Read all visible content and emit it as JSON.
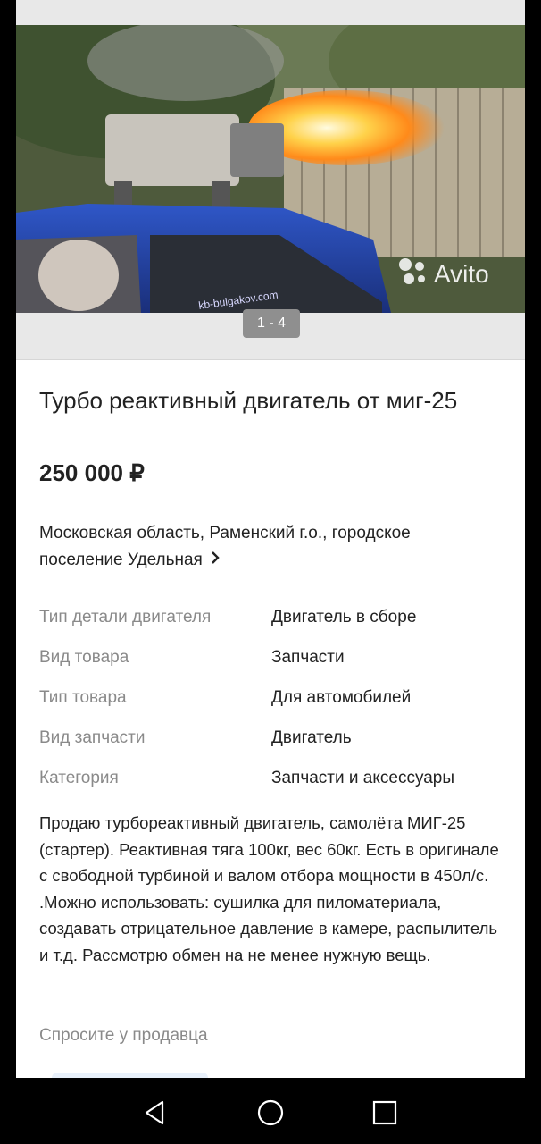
{
  "gallery": {
    "counter": "1 - 4",
    "watermark": "Avito",
    "plate_text": "kb-bulgakov.com"
  },
  "listing": {
    "title": "Турбо реактивный двигатель от миг-25",
    "price": "250 000 ₽",
    "location": "Московская область, Раменский г.о., городское поселение Удельная"
  },
  "params": [
    {
      "key": "Тип детали двигателя",
      "value": "Двигатель в сборе"
    },
    {
      "key": "Вид товара",
      "value": "Запчасти"
    },
    {
      "key": "Тип товара",
      "value": "Для автомобилей"
    },
    {
      "key": "Вид запчасти",
      "value": "Двигатель"
    },
    {
      "key": "Категория",
      "value": "Запчасти и аксессуары"
    }
  ],
  "description": "Продаю турбореактивный двигатель, самолёта МИГ-25 (стартер). Реактивная тяга 100кг, вес 60кг. Есть в оригинале с свободной турбиной и валом отбора мощности в 450л/с. .Можно использовать: сушилка для пиломатериала, создавать отрицательное давление в камере, распылитель и т.д.  Рассмотрю обмен на не менее нужную вещь.",
  "ask_seller": "Спросите у продавца",
  "icons": [
    "chevron-right-icon",
    "back-icon",
    "home-icon",
    "recents-icon"
  ]
}
